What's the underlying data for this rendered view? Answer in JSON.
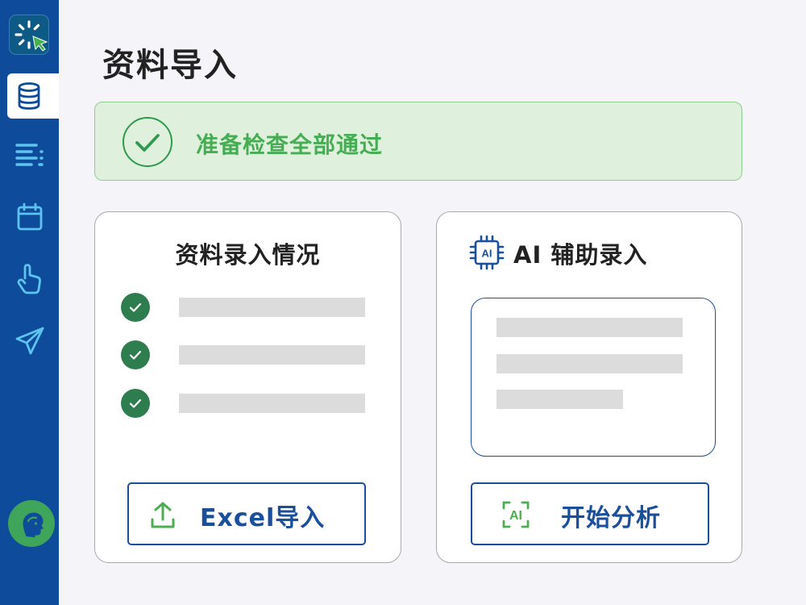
{
  "page": {
    "title": "资料导入"
  },
  "sidebar": {
    "logo_icon": "loading-cursor-logo-icon",
    "items": [
      {
        "icon": "database-icon",
        "active": true
      },
      {
        "icon": "list-icon",
        "active": false
      },
      {
        "icon": "calendar-icon",
        "active": false
      },
      {
        "icon": "hand-pointer-icon",
        "active": false
      },
      {
        "icon": "paper-plane-icon",
        "active": false
      }
    ],
    "help_icon": "support-agent-icon"
  },
  "alert": {
    "text": "准备检查全部通过",
    "status": "success",
    "color": "#45ad53"
  },
  "entry_card": {
    "title": "资料录入情况",
    "items_checked": 3,
    "button_label": "Excel导入",
    "button_icon": "upload-icon"
  },
  "ai_card": {
    "title": "AI 辅助录入",
    "title_icon": "ai-chip-icon",
    "button_label": "开始分析",
    "button_icon": "ai-scan-icon"
  },
  "colors": {
    "sidebar": "#0e4b9a",
    "accent": "#1a4f9c",
    "success": "#2e7d4e",
    "success_bg": "#dff1dc"
  }
}
